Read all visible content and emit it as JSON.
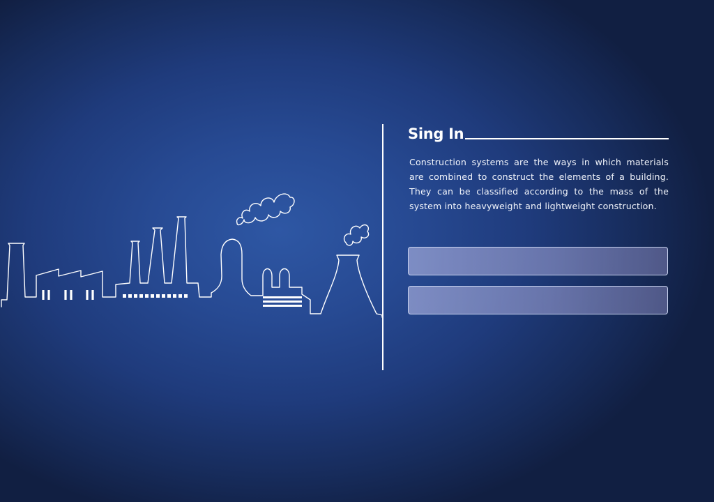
{
  "illustration": {
    "icon": "industrial-skyline-icon",
    "line_color": "#ffffff"
  },
  "login": {
    "title": "Sing In",
    "description": "Construction systems are the ways in which materials are combined to construct the elements of a building. They can be classified according to the mass of the system into heavyweight and lightweight construction.",
    "username": {
      "value": "",
      "placeholder": ""
    },
    "password": {
      "value": "",
      "placeholder": ""
    }
  },
  "colors": {
    "background_center": "#2e57a4",
    "background_edge": "#111f42",
    "field_fill": "#8c94cc",
    "text": "#ffffff"
  }
}
